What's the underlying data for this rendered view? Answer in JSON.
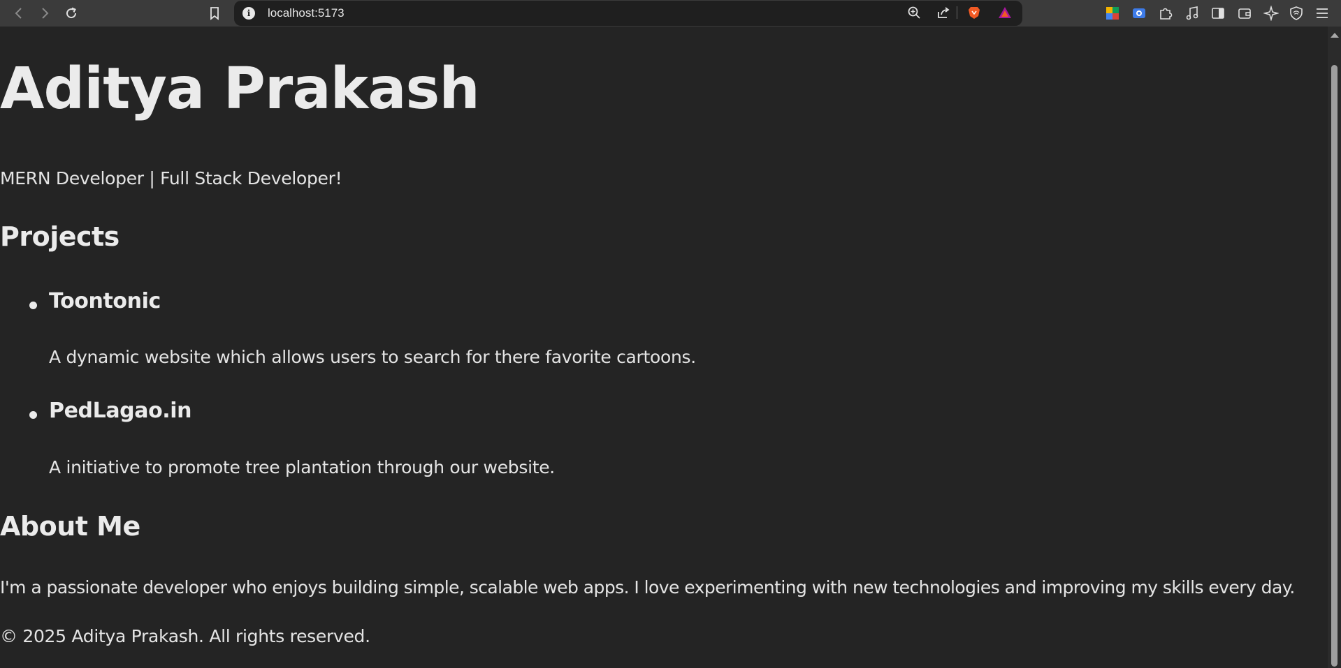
{
  "browser": {
    "url": "localhost:5173",
    "colors": {
      "toolbar": "#3b3b3b",
      "urlbar": "#1f1f1f",
      "page_bg": "#242424"
    }
  },
  "page": {
    "name": "Aditya Prakash",
    "tagline": "MERN Developer | Full Stack Developer!",
    "projects_heading": "Projects",
    "projects": [
      {
        "title": "Toontonic",
        "description": "A dynamic website which allows users to search for there favorite cartoons."
      },
      {
        "title": "PedLagao.in",
        "description": "A initiative to promote tree plantation through our website."
      }
    ],
    "about_heading": "About Me",
    "about_text": "I'm a passionate developer who enjoys building simple, scalable web apps. I love experimenting with new technologies and improving my skills every day.",
    "footer": "© 2025 Aditya Prakash. All rights reserved."
  }
}
